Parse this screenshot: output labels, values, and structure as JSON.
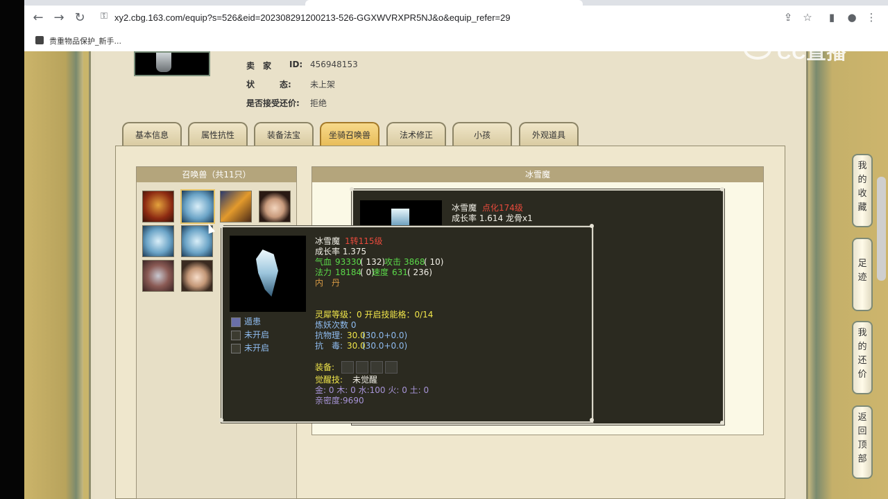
{
  "browser": {
    "url": "xy2.cbg.163.com/equip?s=526&eid=202308291200213-526-GGXWVRXPR5NJ&o&equip_refer=29",
    "bookmark_label": "贵重物品保护_新手...",
    "watermark": "CC直播"
  },
  "seller": {
    "seller_label": "卖　家",
    "id_label": "ID:",
    "id_value": "456948153",
    "status_label": "状　　　态:",
    "status_value": "未上架",
    "bargain_label": "是否接受还价:",
    "bargain_value": "拒绝"
  },
  "tabs": [
    "基本信息",
    "属性抗性",
    "装备法宝",
    "坐骑召唤兽",
    "法术修正",
    "小孩",
    "外观道具"
  ],
  "active_tab": 3,
  "pet_list": {
    "title": "召唤兽（共11只）"
  },
  "detail": {
    "title": "冰雪魔",
    "back_tooltip": {
      "name": "冰雪魔",
      "level": "点化174级",
      "growth": "成长率 1.614 龙骨x1"
    },
    "tooltip": {
      "name": "冰雪魔",
      "level": "1转115级",
      "growth": "成长率 1.375",
      "hp_label": "气血",
      "hp_value": "93330",
      "hp_extra": "( 132)",
      "atk_label": "攻击",
      "atk_value": "3868",
      "atk_extra": "( 10)",
      "mp_label": "法力",
      "mp_value": "18184",
      "mp_extra": "( 0)",
      "spd_label": "速度",
      "spd_value": "631",
      "spd_extra": "( 236)",
      "neidan": "内　丹",
      "skills": [
        "遁患",
        "未开启",
        "未开启"
      ],
      "spirit_level": "灵犀等级：0 开启技能格：0/14",
      "refine": "炼妖次数 0",
      "phys_res_label": "抗物理:",
      "phys_res_value": "30.0",
      "phys_res_detail": "(30.0+0.0)",
      "poison_res_label": "抗　毒:",
      "poison_res_value": "30.0",
      "poison_res_detail": "(30.0+0.0)",
      "equip_label": "装备:",
      "awaken_label": "觉醒技:",
      "awaken_value": "未觉醒",
      "elements": "金: 0 木: 0 水:100 火: 0 土: 0",
      "intimacy": "亲密度:9690"
    }
  },
  "side_buttons": [
    [
      "我",
      "的",
      "收",
      "藏"
    ],
    [
      "足",
      "迹"
    ],
    [
      "我",
      "的",
      "还",
      "价"
    ],
    [
      "返",
      "回",
      "顶",
      "部"
    ]
  ],
  "colors": {
    "tooltip_bg": "#2b2a20",
    "level_red": "#e84a3c",
    "stat_green": "#5bd94a",
    "label_yellow": "#f1e64a",
    "resist_blue": "#8fbcf0",
    "element_purple": "#a895d8"
  }
}
